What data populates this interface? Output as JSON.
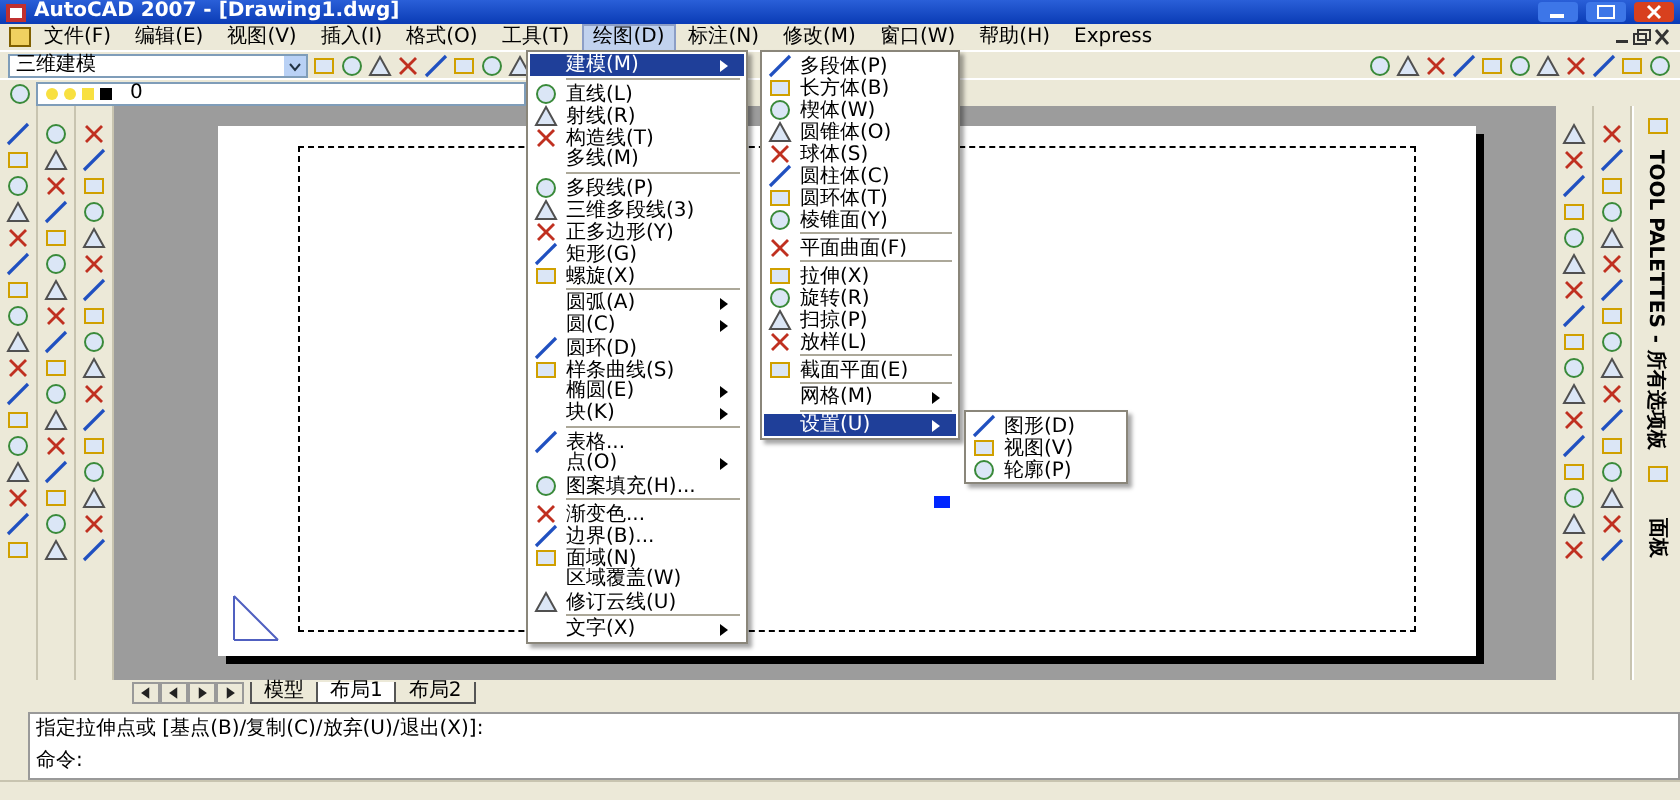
{
  "window": {
    "title": "AutoCAD 2007 - [Drawing1.dwg]"
  },
  "menubar": [
    {
      "label": "文件(F)",
      "selected": false
    },
    {
      "label": "编辑(E)",
      "selected": false
    },
    {
      "label": "视图(V)",
      "selected": false
    },
    {
      "label": "插入(I)",
      "selected": false
    },
    {
      "label": "格式(O)",
      "selected": false
    },
    {
      "label": "工具(T)",
      "selected": false
    },
    {
      "label": "绘图(D)",
      "selected": true
    },
    {
      "label": "标注(N)",
      "selected": false
    },
    {
      "label": "修改(M)",
      "selected": false
    },
    {
      "label": "窗口(W)",
      "selected": false
    },
    {
      "label": "帮助(H)",
      "selected": false
    },
    {
      "label": "Express",
      "selected": false
    }
  ],
  "workspace": {
    "value": "三维建模"
  },
  "layer": {
    "value": "0"
  },
  "draw_menu": [
    {
      "kind": "item",
      "label": "建模(M)",
      "icon": false,
      "submenu": true,
      "selected": true
    },
    {
      "kind": "separator"
    },
    {
      "kind": "item",
      "label": "直线(L)",
      "icon": true,
      "submenu": false,
      "selected": false
    },
    {
      "kind": "item",
      "label": "射线(R)",
      "icon": true,
      "submenu": false,
      "selected": false
    },
    {
      "kind": "item",
      "label": "构造线(T)",
      "icon": true,
      "submenu": false,
      "selected": false
    },
    {
      "kind": "item",
      "label": "多线(M)",
      "icon": false,
      "submenu": false,
      "selected": false
    },
    {
      "kind": "separator"
    },
    {
      "kind": "item",
      "label": "多段线(P)",
      "icon": true,
      "submenu": false,
      "selected": false
    },
    {
      "kind": "item",
      "label": "三维多段线(3)",
      "icon": true,
      "submenu": false,
      "selected": false
    },
    {
      "kind": "item",
      "label": "正多边形(Y)",
      "icon": true,
      "submenu": false,
      "selected": false
    },
    {
      "kind": "item",
      "label": "矩形(G)",
      "icon": true,
      "submenu": false,
      "selected": false
    },
    {
      "kind": "item",
      "label": "螺旋(X)",
      "icon": true,
      "submenu": false,
      "selected": false
    },
    {
      "kind": "separator"
    },
    {
      "kind": "item",
      "label": "圆弧(A)",
      "icon": false,
      "submenu": true,
      "selected": false
    },
    {
      "kind": "item",
      "label": "圆(C)",
      "icon": false,
      "submenu": true,
      "selected": false
    },
    {
      "kind": "item",
      "label": "圆环(D)",
      "icon": true,
      "submenu": false,
      "selected": false
    },
    {
      "kind": "item",
      "label": "样条曲线(S)",
      "icon": true,
      "submenu": false,
      "selected": false
    },
    {
      "kind": "item",
      "label": "椭圆(E)",
      "icon": false,
      "submenu": true,
      "selected": false
    },
    {
      "kind": "item",
      "label": "块(K)",
      "icon": false,
      "submenu": true,
      "selected": false
    },
    {
      "kind": "separator"
    },
    {
      "kind": "item",
      "label": "表格...",
      "icon": true,
      "submenu": false,
      "selected": false
    },
    {
      "kind": "item",
      "label": "点(O)",
      "icon": false,
      "submenu": true,
      "selected": false
    },
    {
      "kind": "item",
      "label": "图案填充(H)...",
      "icon": true,
      "submenu": false,
      "selected": false
    },
    {
      "kind": "separator"
    },
    {
      "kind": "item",
      "label": "渐变色...",
      "icon": true,
      "submenu": false,
      "selected": false
    },
    {
      "kind": "item",
      "label": "边界(B)...",
      "icon": true,
      "submenu": false,
      "selected": false
    },
    {
      "kind": "item",
      "label": "面域(N)",
      "icon": true,
      "submenu": false,
      "selected": false
    },
    {
      "kind": "item",
      "label": "区域覆盖(W)",
      "icon": false,
      "submenu": false,
      "selected": false
    },
    {
      "kind": "item",
      "label": "修订云线(U)",
      "icon": true,
      "submenu": false,
      "selected": false
    },
    {
      "kind": "separator"
    },
    {
      "kind": "item",
      "label": "文字(X)",
      "icon": false,
      "submenu": true,
      "selected": false
    }
  ],
  "modeling_menu": [
    {
      "kind": "item",
      "label": "多段体(P)",
      "icon": true,
      "submenu": false,
      "selected": false
    },
    {
      "kind": "item",
      "label": "长方体(B)",
      "icon": true,
      "submenu": false,
      "selected": false
    },
    {
      "kind": "item",
      "label": "楔体(W)",
      "icon": true,
      "submenu": false,
      "selected": false
    },
    {
      "kind": "item",
      "label": "圆锥体(O)",
      "icon": true,
      "submenu": false,
      "selected": false
    },
    {
      "kind": "item",
      "label": "球体(S)",
      "icon": true,
      "submenu": false,
      "selected": false
    },
    {
      "kind": "item",
      "label": "圆柱体(C)",
      "icon": true,
      "submenu": false,
      "selected": false
    },
    {
      "kind": "item",
      "label": "圆环体(T)",
      "icon": true,
      "submenu": false,
      "selected": false
    },
    {
      "kind": "item",
      "label": "棱锥面(Y)",
      "icon": true,
      "submenu": false,
      "selected": false
    },
    {
      "kind": "separator"
    },
    {
      "kind": "item",
      "label": "平面曲面(F)",
      "icon": true,
      "submenu": false,
      "selected": false
    },
    {
      "kind": "separator"
    },
    {
      "kind": "item",
      "label": "拉伸(X)",
      "icon": true,
      "submenu": false,
      "selected": false
    },
    {
      "kind": "item",
      "label": "旋转(R)",
      "icon": true,
      "submenu": false,
      "selected": false
    },
    {
      "kind": "item",
      "label": "扫掠(P)",
      "icon": true,
      "submenu": false,
      "selected": false
    },
    {
      "kind": "item",
      "label": "放样(L)",
      "icon": true,
      "submenu": false,
      "selected": false
    },
    {
      "kind": "separator"
    },
    {
      "kind": "item",
      "label": "截面平面(E)",
      "icon": true,
      "submenu": false,
      "selected": false
    },
    {
      "kind": "separator"
    },
    {
      "kind": "item",
      "label": "网格(M)",
      "icon": false,
      "submenu": true,
      "selected": false
    },
    {
      "kind": "separator"
    },
    {
      "kind": "item",
      "label": "设置(U)",
      "icon": false,
      "submenu": true,
      "selected": true
    }
  ],
  "setup_menu": [
    {
      "kind": "item",
      "label": "图形(D)",
      "icon": true,
      "submenu": false,
      "selected": false
    },
    {
      "kind": "item",
      "label": "视图(V)",
      "icon": true,
      "submenu": false,
      "selected": false
    },
    {
      "kind": "item",
      "label": "轮廓(P)",
      "icon": true,
      "submenu": false,
      "selected": false
    }
  ],
  "layout_tabs": [
    {
      "label": "模型",
      "selected": false
    },
    {
      "label": "布局1",
      "selected": true
    },
    {
      "label": "布局2",
      "selected": false
    }
  ],
  "command_lines": [
    "指定拉伸点或 [基点(B)/复制(C)/放弃(U)/退出(X)]:",
    "命令:"
  ],
  "palette": {
    "title": "TOOL PALETTES - 所有选项板",
    "tab": "面板"
  }
}
